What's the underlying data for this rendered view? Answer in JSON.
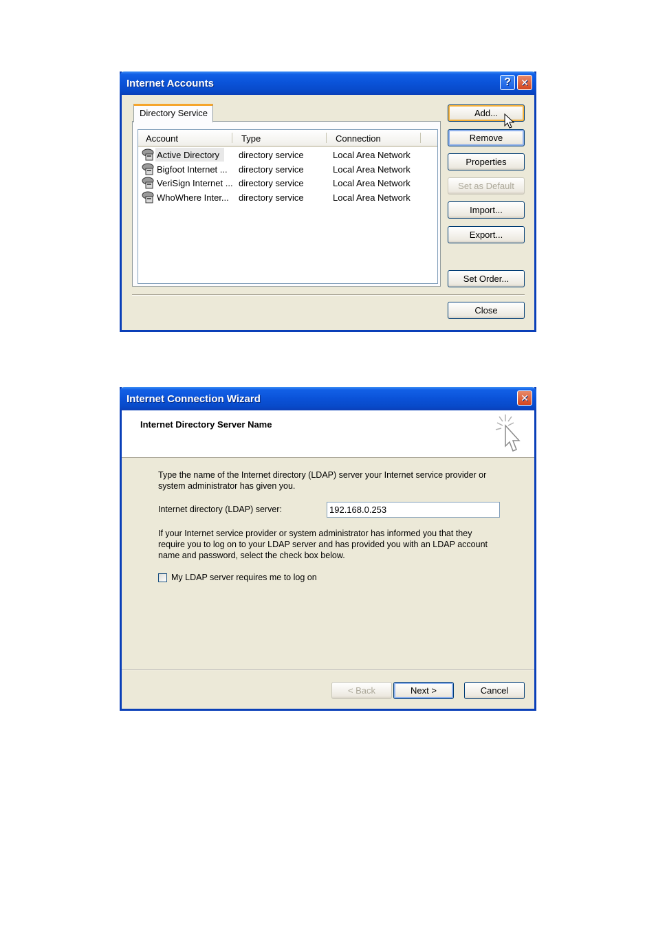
{
  "accounts_dialog": {
    "title": "Internet Accounts",
    "help_glyph": "?",
    "close_glyph": "✕",
    "tab_label": "Directory Service",
    "columns": [
      "Account",
      "Type",
      "Connection"
    ],
    "rows": [
      {
        "account": "Active Directory",
        "type": "directory service",
        "connection": "Local Area Network"
      },
      {
        "account": "Bigfoot Internet ...",
        "type": "directory service",
        "connection": "Local Area Network"
      },
      {
        "account": "VeriSign Internet ...",
        "type": "directory service",
        "connection": "Local Area Network"
      },
      {
        "account": "WhoWhere Inter...",
        "type": "directory service",
        "connection": "Local Area Network"
      }
    ],
    "buttons": {
      "add": "Add...",
      "remove": "Remove",
      "properties": "Properties",
      "set_default": "Set as Default",
      "import": "Import...",
      "export": "Export...",
      "set_order": "Set Order...",
      "close": "Close"
    },
    "icons": {
      "account_row": "address-book-icon",
      "cursor": "mouse-pointer-icon"
    }
  },
  "wizard_dialog": {
    "title": "Internet Connection Wizard",
    "close_glyph": "✕",
    "header_title": "Internet Directory Server Name",
    "intro_line1": "Type the name of the Internet directory (LDAP) server your Internet service provider or",
    "intro_line2": "system administrator has given you.",
    "server_label": "Internet directory (LDAP) server:",
    "server_value": "192.168.0.253",
    "info_line1": "If your Internet service provider or system administrator has informed you that they",
    "info_line2": "require you to log on to your LDAP server and has provided you with an LDAP account",
    "info_line3": "name and password, select the check box below.",
    "checkbox_label": "My LDAP server requires me to log on",
    "checkbox_checked": false,
    "buttons": {
      "back": "< Back",
      "next": "Next >",
      "cancel": "Cancel"
    },
    "icons": {
      "header": "wizard-pointer-icon"
    }
  }
}
